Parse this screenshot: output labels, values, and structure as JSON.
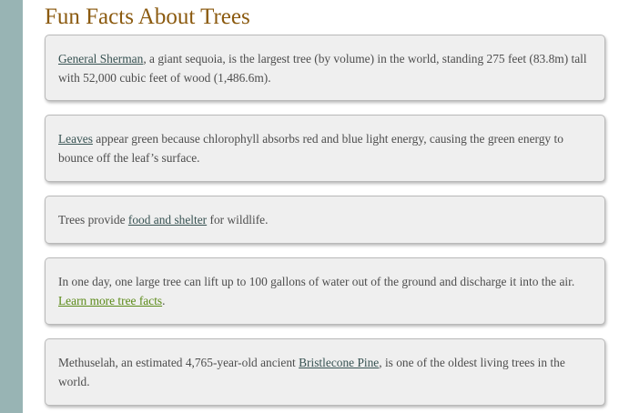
{
  "page": {
    "title": "Fun Facts About Trees"
  },
  "facts": [
    {
      "link": "General Sherman",
      "after": ", a giant sequoia, is the largest tree (by volume) in the world, standing 275 feet (83.8m) tall with 52,000 cubic feet of wood (1,486.6m)."
    },
    {
      "link": "Leaves",
      "after": " appear green because chlorophyll absorbs red and blue light energy, causing the green energy to bounce off the leaf’s surface."
    },
    {
      "before": "Trees provide ",
      "link": "food and shelter",
      "after": " for wildlife."
    },
    {
      "before": "In one day, one large tree can lift up to 100 gallons of water out of the ground and discharge it into the air. ",
      "link": "Learn more tree facts",
      "after": "."
    },
    {
      "before": "Methuselah, an estimated 4,765-year-old ancient ",
      "link": "Bristlecone Pine",
      "after": ", is one of the oldest living trees in the world."
    }
  ],
  "colors": {
    "sidebar": "#98b4b4",
    "title": "#8b5a0f",
    "card_background": "#efefef",
    "body_text": "#4d4d4d",
    "link": "#375252",
    "learn_more_link": "#5b8a18"
  }
}
